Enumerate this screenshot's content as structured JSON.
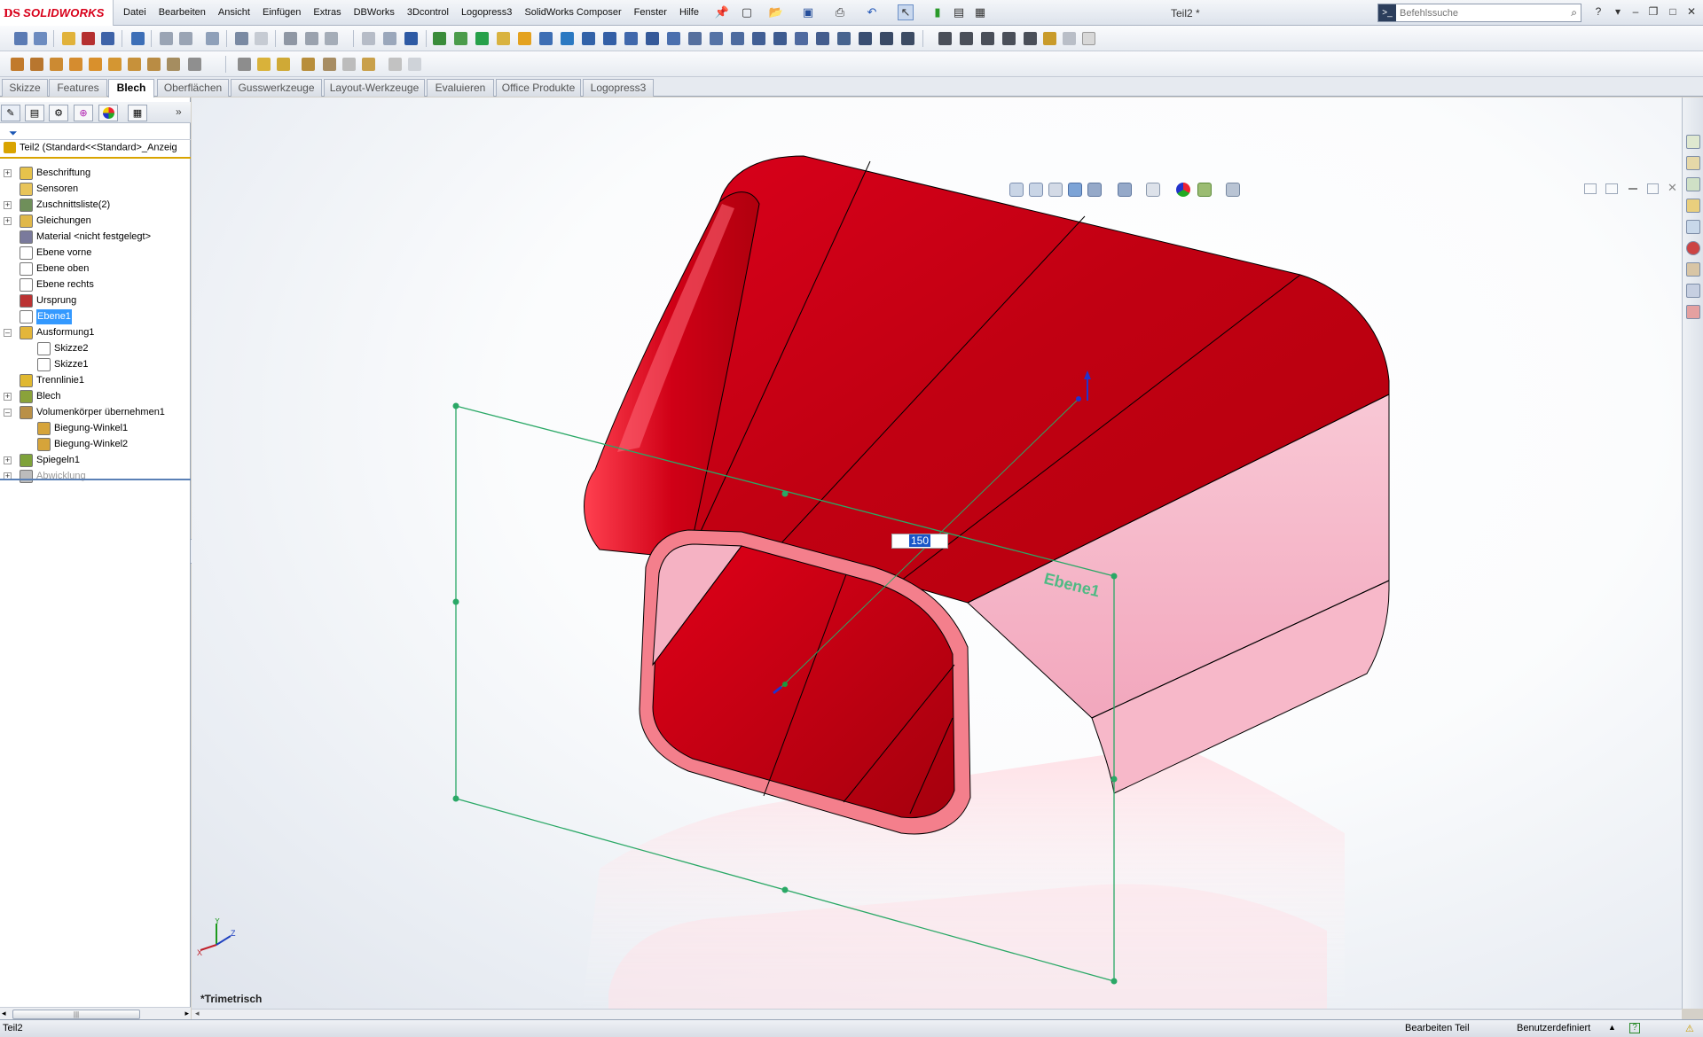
{
  "app": {
    "brand_ds": "DS",
    "brand_name": "SOLIDWORKS",
    "doc_title": "Teil2 *"
  },
  "menu": [
    "Datei",
    "Bearbeiten",
    "Ansicht",
    "Einfügen",
    "Extras",
    "DBWorks",
    "3Dcontrol",
    "Logopress3",
    "SolidWorks Composer",
    "Fenster",
    "Hilfe"
  ],
  "search": {
    "placeholder": "Befehlssuche"
  },
  "tabs": [
    "Skizze",
    "Features",
    "Blech",
    "Oberflächen",
    "Gusswerkzeuge",
    "Layout-Werkzeuge",
    "Evaluieren",
    "Office Produkte",
    "Logopress3"
  ],
  "active_tab": "Blech",
  "feature_tree": {
    "root": "Teil2  (Standard<<Standard>_Anzeig",
    "items": [
      {
        "label": "Beschriftung",
        "icon": "annotation-icon",
        "expand": true
      },
      {
        "label": "Sensoren",
        "icon": "sensor-icon",
        "expand": false
      },
      {
        "label": "Zuschnittsliste(2)",
        "icon": "cutlist-icon",
        "expand": true
      },
      {
        "label": "Gleichungen",
        "icon": "equations-icon",
        "expand": true
      },
      {
        "label": "Material <nicht festgelegt>",
        "icon": "material-icon",
        "expand": false
      },
      {
        "label": "Ebene vorne",
        "icon": "plane-icon",
        "expand": false
      },
      {
        "label": "Ebene oben",
        "icon": "plane-icon",
        "expand": false
      },
      {
        "label": "Ebene rechts",
        "icon": "plane-icon",
        "expand": false
      },
      {
        "label": "Ursprung",
        "icon": "origin-icon",
        "expand": false
      },
      {
        "label": "Ebene1",
        "icon": "plane-icon",
        "expand": false,
        "selected": true
      },
      {
        "label": "Ausformung1",
        "icon": "loft-icon",
        "expand": true,
        "open": true
      },
      {
        "label": "Skizze2",
        "icon": "sketch-icon",
        "child": true
      },
      {
        "label": "Skizze1",
        "icon": "sketch-icon",
        "child": true
      },
      {
        "label": "Trennlinie1",
        "icon": "splitline-icon",
        "expand": false
      },
      {
        "label": "Blech",
        "icon": "sheetmetal-icon",
        "expand": true
      },
      {
        "label": "Volumenkörper übernehmen1",
        "icon": "convert-solid-icon",
        "expand": true,
        "open": true
      },
      {
        "label": "Biegung-Winkel1",
        "icon": "bend-icon",
        "child": true
      },
      {
        "label": "Biegung-Winkel2",
        "icon": "bend-icon",
        "child": true
      },
      {
        "label": "Spiegeln1",
        "icon": "mirror-icon",
        "expand": true
      },
      {
        "label": "Abwicklung",
        "icon": "flatten-icon",
        "expand": true,
        "suppressed": true
      }
    ]
  },
  "viewport": {
    "view_name": "*Trimetrisch",
    "dimension_value": "150",
    "plane_label": "Ebene1",
    "body_color": "#cc0010",
    "inner_color": "#f5b8c8",
    "plane_color": "#2aa866"
  },
  "status": {
    "left": "Teil2",
    "mode": "Bearbeiten Teil",
    "units": "Benutzerdefiniert"
  }
}
